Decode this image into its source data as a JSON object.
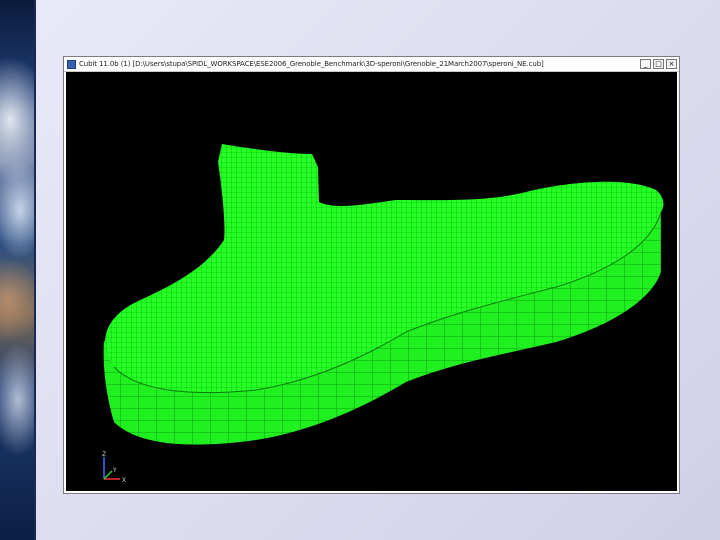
{
  "window": {
    "title": "Cubit 11.0b (1) [D:\\Users\\stupa\\SPIDL_WORKSPACE\\ESE2006_Grenoble_Benchmark\\3D-speroni\\Grenoble_21March2007\\speroni_NE.cub]",
    "minimize_label": "_",
    "maximize_label": "□",
    "close_label": "×"
  },
  "viewport": {
    "background": "#000000",
    "mesh_color": "#22ff22",
    "mesh_line_color": "#0a9a0a"
  },
  "axes": {
    "y_label": "Y",
    "z_label": "Z",
    "x_label": "X"
  },
  "colors": {
    "slide_background": "#dcdcf0",
    "window_border": "#7d7d7d"
  }
}
